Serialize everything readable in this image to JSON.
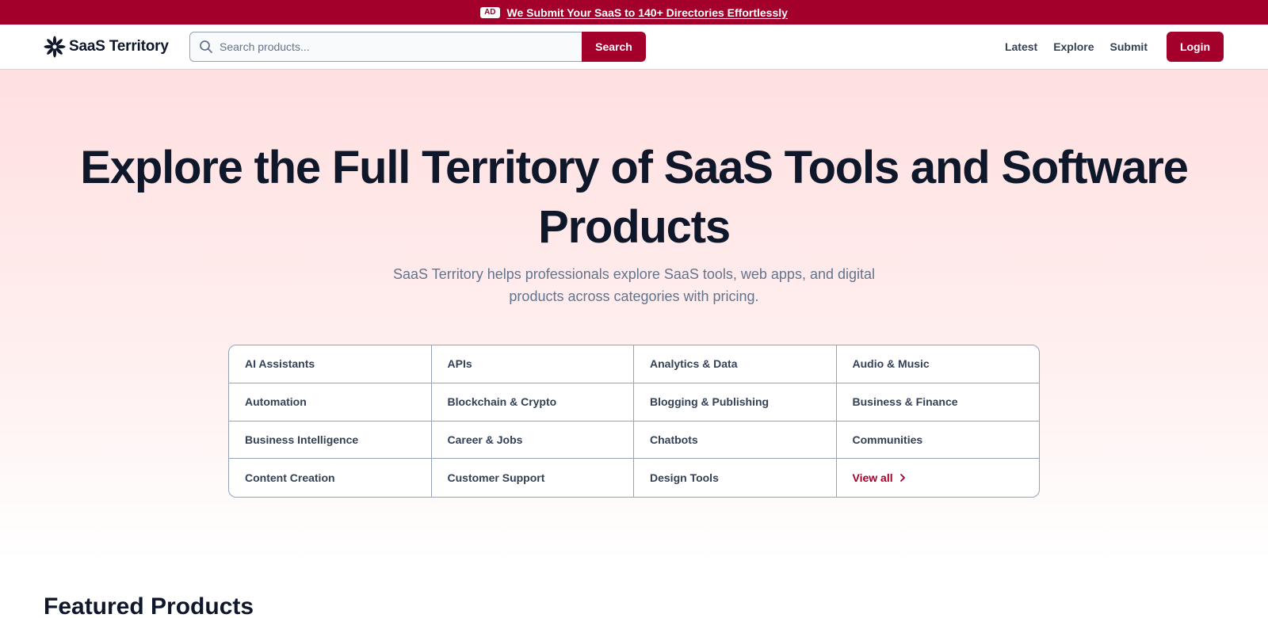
{
  "ad_bar": {
    "badge": "AD",
    "text": "We Submit Your SaaS to 140+ Directories Effortlessly"
  },
  "header": {
    "logo_text": "SaaS Territory",
    "search": {
      "placeholder": "Search products...",
      "value": "",
      "button_label": "Search"
    },
    "nav": {
      "latest": "Latest",
      "explore": "Explore",
      "submit": "Submit",
      "login": "Login"
    }
  },
  "hero": {
    "title": "Explore the Full Territory of SaaS Tools and Software Products",
    "subtitle": "SaaS Territory helps professionals explore SaaS tools, web apps, and digital products across categories with pricing."
  },
  "categories": [
    "AI Assistants",
    "APIs",
    "Analytics & Data",
    "Audio & Music",
    "Automation",
    "Blockchain & Crypto",
    "Blogging & Publishing",
    "Business & Finance",
    "Business Intelligence",
    "Career & Jobs",
    "Chatbots",
    "Communities",
    "Content Creation",
    "Customer Support",
    "Design Tools"
  ],
  "view_all_label": "View all",
  "featured": {
    "title": "Featured Products"
  },
  "colors": {
    "brand": "#a3002b",
    "hero_gradient_top": "#ffdfe0",
    "text_dark": "#0f172a",
    "text_muted": "#64748b"
  },
  "icons": {
    "logo": "flower-star-icon",
    "search": "search-icon",
    "view_all": "chevron-right-icon"
  }
}
